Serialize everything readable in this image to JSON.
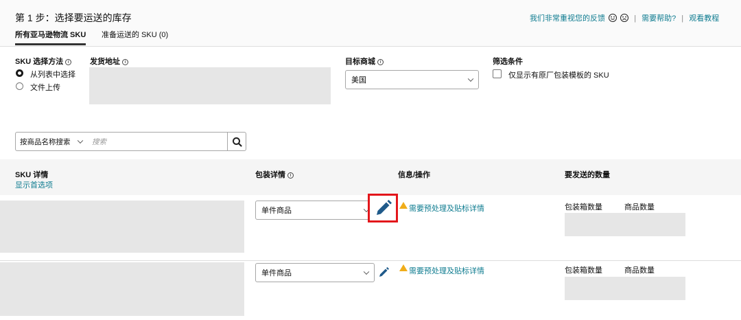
{
  "header": {
    "step_title": "第 1 步：选择要运送的库存",
    "feedback_text": "我们非常重视您的反馈",
    "separator": "|",
    "help_link": "需要帮助?",
    "tutorial_link": "观看教程",
    "tabs": [
      {
        "label": "所有亚马逊物流 SKU",
        "active": true
      },
      {
        "label": "准备运送的 SKU (0)",
        "active": false
      }
    ]
  },
  "form": {
    "sku_method_label": "SKU 选择方法",
    "sku_method_options": [
      {
        "label": "从列表中选择",
        "checked": true
      },
      {
        "label": "文件上传",
        "checked": false
      }
    ],
    "ship_from_label": "发货地址",
    "marketplace_label": "目标商城",
    "marketplace_value": "美国",
    "filter_label": "筛选条件",
    "filter_checkbox_label": "仅显示有原厂包装模板的 SKU",
    "search_by_value": "按商品名称搜索",
    "search_placeholder": "搜索"
  },
  "table": {
    "col_sku": "SKU 详情",
    "show_preferences": "显示首选项",
    "col_packing": "包装详情",
    "col_info": "信息/操作",
    "col_quantity": "要发送的数量",
    "rows": [
      {
        "packing_value": "单件商品",
        "info_link": "需要预处理及贴标详情",
        "boxes_label": "包装箱数量",
        "units_label": "商品数量"
      },
      {
        "packing_value": "单件商品",
        "info_link": "需要预处理及贴标详情",
        "boxes_label": "包装箱数量",
        "units_label": "商品数量"
      }
    ]
  },
  "colors": {
    "link": "#0f7c90",
    "warning": "#f0ad1a",
    "highlight": "#e3161b",
    "pencil": "#1f5a8a"
  },
  "icons": [
    "info-icon",
    "happy-face-icon",
    "sad-face-icon",
    "search-icon",
    "chevron-down-icon",
    "pencil-icon",
    "warning-icon"
  ]
}
